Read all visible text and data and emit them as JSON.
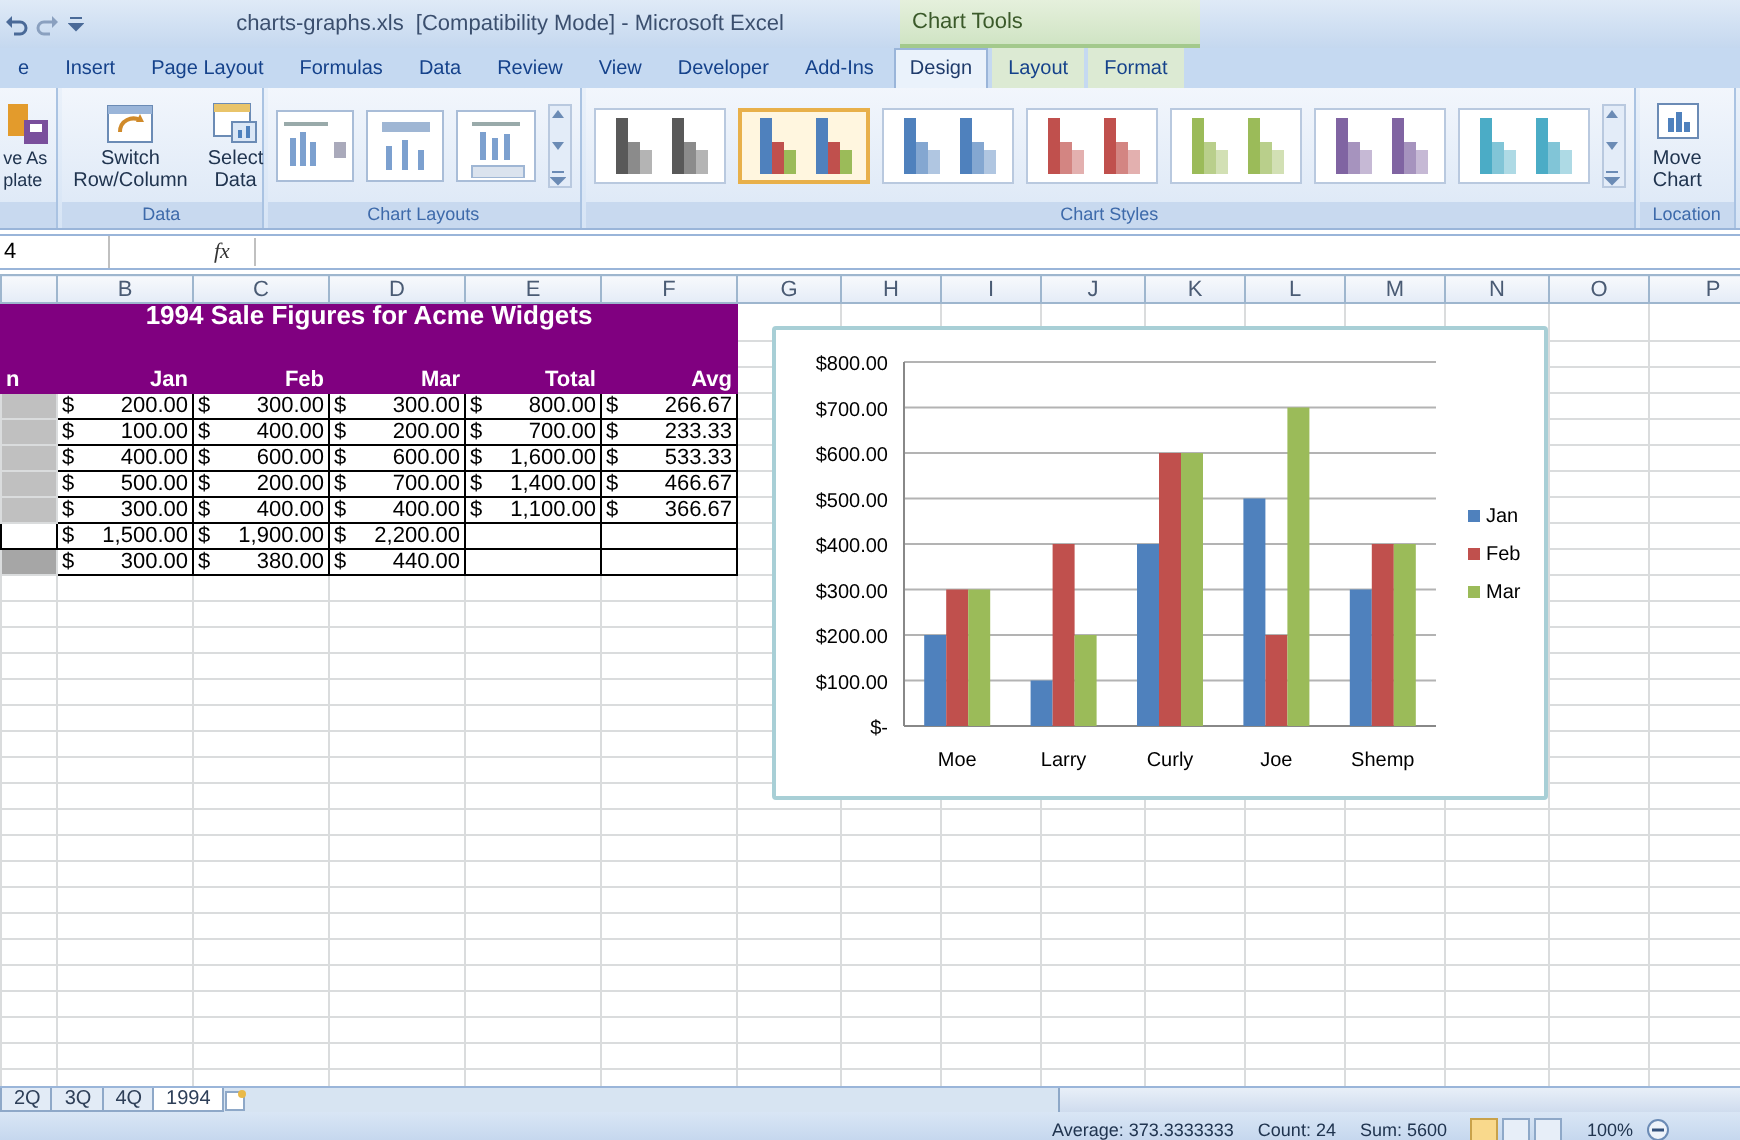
{
  "title_bar": {
    "title": "charts-graphs.xls  [Compatibility Mode] - Microsoft Excel",
    "context_label": "Chart Tools"
  },
  "tabs": [
    {
      "label": "e",
      "selected": false
    },
    {
      "label": "Insert",
      "selected": false
    },
    {
      "label": "Page Layout",
      "selected": false
    },
    {
      "label": "Formulas",
      "selected": false
    },
    {
      "label": "Data",
      "selected": false
    },
    {
      "label": "Review",
      "selected": false
    },
    {
      "label": "View",
      "selected": false
    },
    {
      "label": "Developer",
      "selected": false
    },
    {
      "label": "Add-Ins",
      "selected": false
    },
    {
      "label": "Design",
      "selected": true,
      "contextual": true
    },
    {
      "label": "Layout",
      "selected": false,
      "contextual": true
    },
    {
      "label": "Format",
      "selected": false,
      "contextual": true
    }
  ],
  "ribbon": {
    "groups": [
      {
        "kind": "buttons",
        "buttons": [
          {
            "kind": "template",
            "lines": [
              "ve As",
              "plate"
            ]
          }
        ]
      },
      {
        "kind": "buttons",
        "label": "Data",
        "buttons": [
          {
            "kind": "switch",
            "lines": [
              "Switch",
              "Row/Column"
            ]
          },
          {
            "kind": "select",
            "lines": [
              "Select",
              "Data"
            ]
          }
        ]
      },
      {
        "kind": "layouts",
        "label": "Chart Layouts",
        "items": [
          {
            "kind": "legend_right"
          },
          {
            "kind": "title_top"
          },
          {
            "kind": "table_below"
          }
        ]
      },
      {
        "kind": "styles",
        "label": "Chart Styles",
        "items": [
          {
            "kind": "mono",
            "color": "#595959",
            "selected": false
          },
          {
            "kind": "multi",
            "selected": true
          },
          {
            "kind": "mono",
            "color": "#4f81bd",
            "selected": false
          },
          {
            "kind": "mono",
            "color": "#c0504d",
            "selected": false
          },
          {
            "kind": "mono",
            "color": "#9bbb59",
            "selected": false
          },
          {
            "kind": "mono",
            "color": "#8064a2",
            "selected": false
          },
          {
            "kind": "mono",
            "color": "#4bacc6",
            "selected": false
          }
        ]
      },
      {
        "kind": "buttons",
        "label": "Location",
        "buttons": [
          {
            "kind": "move",
            "lines": [
              "Move",
              "Chart"
            ]
          }
        ]
      }
    ]
  },
  "formula_bar": {
    "name_box": "4",
    "function_label": "fx"
  },
  "sheet": {
    "columns": [
      "B",
      "C",
      "D",
      "E",
      "F",
      "G",
      "H",
      "I",
      "J",
      "K",
      "L",
      "M",
      "N",
      "O",
      "P"
    ],
    "title": "1994 Sale Figures for Acme Widgets",
    "header": [
      "n",
      "Jan",
      "Feb",
      "Mar",
      "Total",
      "Avg"
    ],
    "rows": [
      {
        "kind": "data",
        "cells": [
          {
            "symbol": "$",
            "amount": "200.00"
          },
          {
            "symbol": "$",
            "amount": "300.00"
          },
          {
            "symbol": "$",
            "amount": "300.00"
          },
          {
            "symbol": "$",
            "amount": "800.00"
          },
          {
            "symbol": "$",
            "amount": "266.67"
          }
        ]
      },
      {
        "kind": "data",
        "cells": [
          {
            "symbol": "$",
            "amount": "100.00"
          },
          {
            "symbol": "$",
            "amount": "400.00"
          },
          {
            "symbol": "$",
            "amount": "200.00"
          },
          {
            "symbol": "$",
            "amount": "700.00"
          },
          {
            "symbol": "$",
            "amount": "233.33"
          }
        ]
      },
      {
        "kind": "data",
        "cells": [
          {
            "symbol": "$",
            "amount": "400.00"
          },
          {
            "symbol": "$",
            "amount": "600.00"
          },
          {
            "symbol": "$",
            "amount": "600.00"
          },
          {
            "symbol": "$",
            "amount": "1,600.00"
          },
          {
            "symbol": "$",
            "amount": "533.33"
          }
        ]
      },
      {
        "kind": "data",
        "cells": [
          {
            "symbol": "$",
            "amount": "500.00"
          },
          {
            "symbol": "$",
            "amount": "200.00"
          },
          {
            "symbol": "$",
            "amount": "700.00"
          },
          {
            "symbol": "$",
            "amount": "1,400.00"
          },
          {
            "symbol": "$",
            "amount": "466.67"
          }
        ]
      },
      {
        "kind": "data",
        "cells": [
          {
            "symbol": "$",
            "amount": "300.00"
          },
          {
            "symbol": "$",
            "amount": "400.00"
          },
          {
            "symbol": "$",
            "amount": "400.00"
          },
          {
            "symbol": "$",
            "amount": "1,100.00"
          },
          {
            "symbol": "$",
            "amount": "366.67"
          }
        ]
      },
      {
        "kind": "total",
        "cells": [
          {
            "symbol": "$",
            "amount": "1,500.00"
          },
          {
            "symbol": "$",
            "amount": "1,900.00"
          },
          {
            "symbol": "$",
            "amount": "2,200.00"
          }
        ]
      },
      {
        "kind": "average",
        "cells": [
          {
            "symbol": "$",
            "amount": "300.00"
          },
          {
            "symbol": "$",
            "amount": "380.00"
          },
          {
            "symbol": "$",
            "amount": "440.00"
          }
        ]
      }
    ]
  },
  "chart": {
    "chart_data": {
      "type": "bar",
      "grid": true,
      "legend": true,
      "categories": [
        "Moe",
        "Larry",
        "Curly",
        "Joe",
        "Shemp"
      ],
      "series": [
        {
          "name": "Jan",
          "color": "#4f81bd",
          "values": [
            200,
            100,
            400,
            500,
            300
          ]
        },
        {
          "name": "Feb",
          "color": "#c0504d",
          "values": [
            300,
            400,
            600,
            200,
            400
          ]
        },
        {
          "name": "Mar",
          "color": "#9bbb59",
          "values": [
            300,
            200,
            600,
            700,
            400
          ]
        }
      ],
      "ylim": [
        0,
        800
      ],
      "yticks": [
        {
          "value": 0,
          "label": "$-"
        },
        {
          "value": 100,
          "label": "$100.00"
        },
        {
          "value": 200,
          "label": "$200.00"
        },
        {
          "value": 300,
          "label": "$300.00"
        },
        {
          "value": 400,
          "label": "$400.00"
        },
        {
          "value": 500,
          "label": "$500.00"
        },
        {
          "value": 600,
          "label": "$600.00"
        },
        {
          "value": 700,
          "label": "$700.00"
        },
        {
          "value": 800,
          "label": "$800.00"
        }
      ]
    }
  },
  "sheet_tabs": [
    {
      "label": "2Q",
      "selected": false
    },
    {
      "label": "3Q",
      "selected": false
    },
    {
      "label": "4Q",
      "selected": false
    },
    {
      "label": "1994",
      "selected": true
    }
  ],
  "status_bar": {
    "average": "Average: 373.3333333",
    "count": "Count: 24",
    "sum": "Sum: 5600",
    "views": [
      {
        "selected": true
      },
      {
        "selected": false
      },
      {
        "selected": false
      }
    ],
    "zoom": "100%"
  }
}
